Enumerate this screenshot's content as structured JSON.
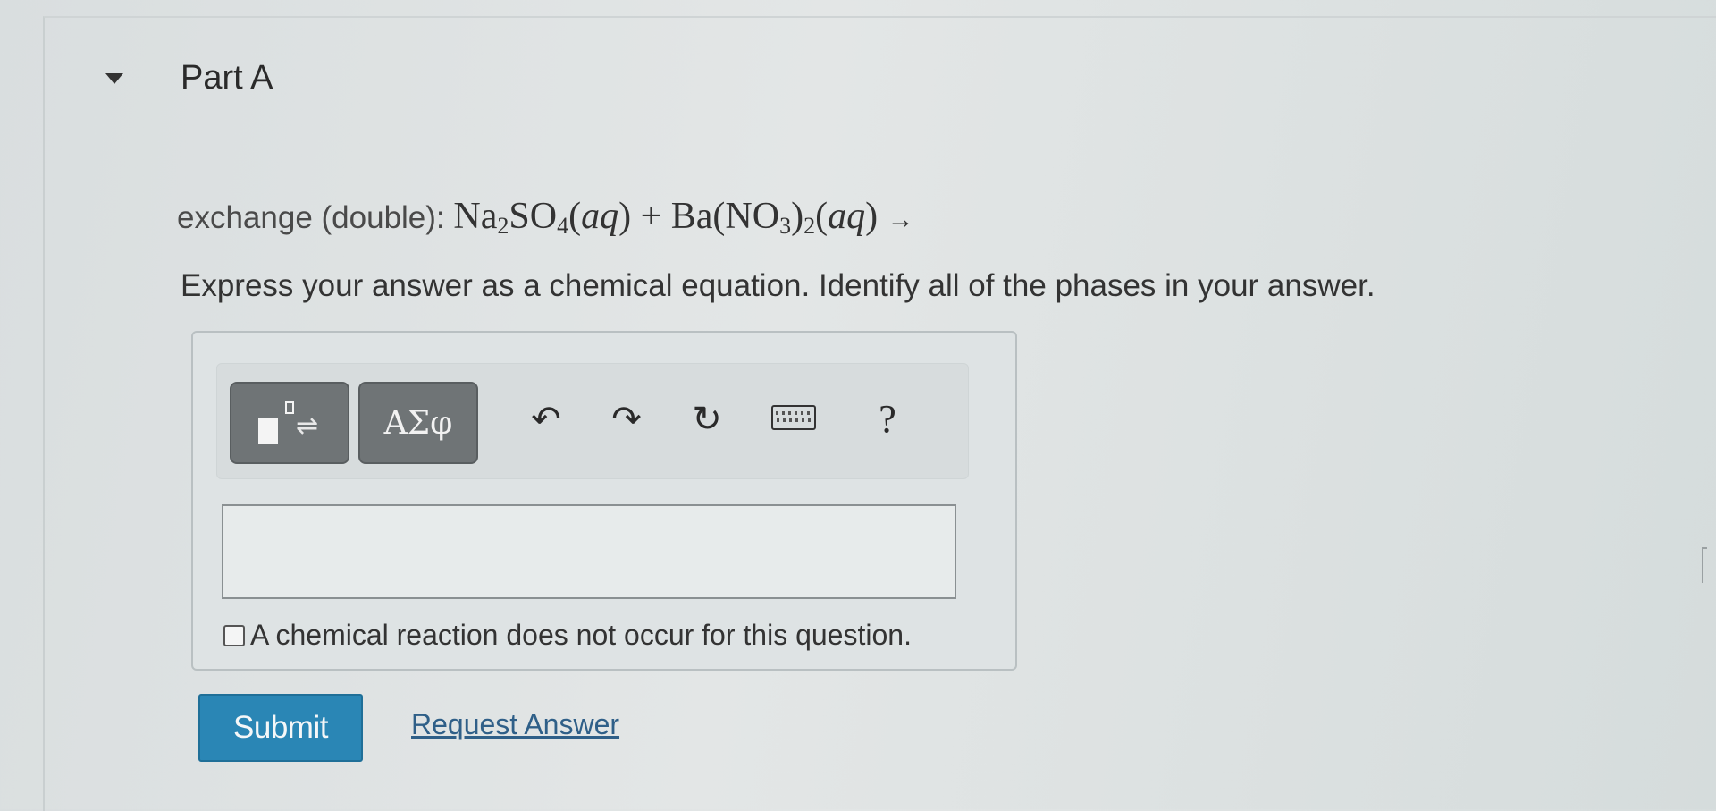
{
  "part": {
    "title": "Part A"
  },
  "question": {
    "prefix": "exchange (double): ",
    "reactant1": {
      "el1": "Na",
      "sub1": "2",
      "el2": "SO",
      "sub2": "4",
      "phase": "aq"
    },
    "plus": " + ",
    "reactant2": {
      "el1": "Ba(NO",
      "sub1": "3",
      "el2": ")",
      "sub2": "2",
      "phase": "aq"
    },
    "arrow": "→"
  },
  "instruction": "Express your answer as a chemical equation. Identify all of the phases in your answer.",
  "toolbar": {
    "templates_icon": "templates-icon",
    "symbols_label": "ΑΣφ",
    "undo_icon": "undo-icon",
    "undo_glyph": "↶",
    "redo_icon": "redo-icon",
    "redo_glyph": "↷",
    "reset_icon": "reset-icon",
    "reset_glyph": "↻",
    "keyboard_icon": "keyboard-icon",
    "help_label": "?"
  },
  "answer": {
    "value": ""
  },
  "no_reaction": {
    "label": "A chemical reaction does not occur for this question.",
    "checked": false
  },
  "actions": {
    "submit_label": "Submit",
    "request_answer_label": "Request Answer"
  },
  "colors": {
    "submit_bg": "#2a86b5",
    "link": "#2f5f88",
    "toolbar_button": "#6f7476"
  }
}
